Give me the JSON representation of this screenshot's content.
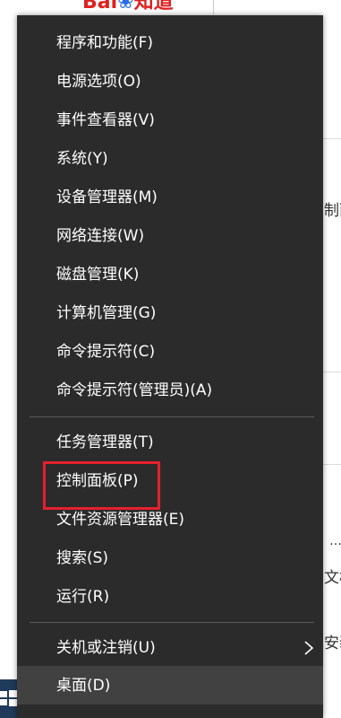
{
  "background": {
    "logo_text": "Bai",
    "logo_paw": "❀",
    "logo_tail": "知道",
    "fragments": [
      "制面",
      "…",
      "文档",
      "安装"
    ]
  },
  "menu": {
    "group1": [
      "程序和功能(F)",
      "电源选项(O)",
      "事件查看器(V)",
      "系统(Y)",
      "设备管理器(M)",
      "网络连接(W)",
      "磁盘管理(K)",
      "计算机管理(G)",
      "命令提示符(C)",
      "命令提示符(管理员)(A)"
    ],
    "group2": [
      "任务管理器(T)",
      "控制面板(P)",
      "文件资源管理器(E)",
      "搜索(S)",
      "运行(R)"
    ],
    "group3": [
      "关机或注销(U)",
      "桌面(D)"
    ],
    "highlighted_item": "控制面板(P)",
    "hovered_item": "桌面(D)"
  },
  "colors": {
    "menu_bg": "#2b2b2b",
    "menu_hover": "#414141",
    "highlight_border": "#e5202e",
    "baidu_red": "#e02020",
    "baidu_blue": "#2b6de8",
    "taskbar": "#1f3a5a"
  },
  "icons": {
    "submenu_arrow": "chevron-right-icon",
    "start_button": "windows-start-icon"
  }
}
